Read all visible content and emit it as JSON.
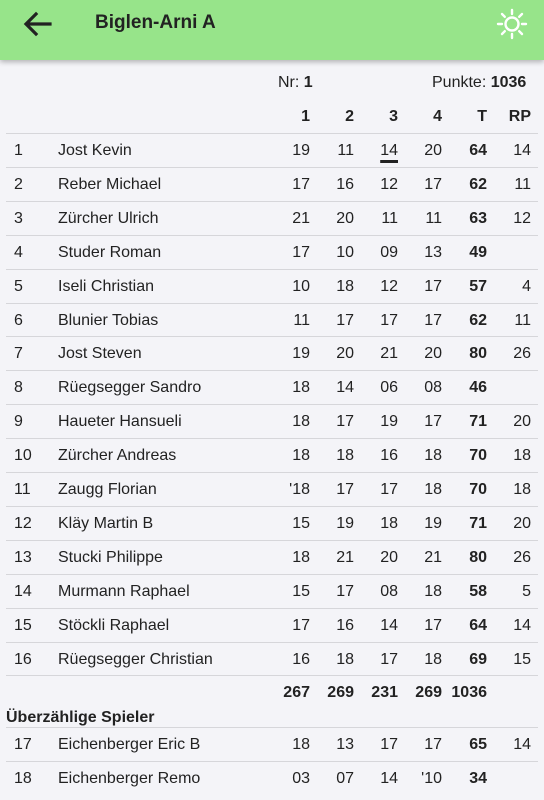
{
  "appbar": {
    "title": "Biglen-Arni A"
  },
  "info": {
    "nr_label": "Nr:",
    "nr_value": "1",
    "punkte_label": "Punkte:",
    "punkte_value": "1036"
  },
  "headers": [
    "1",
    "2",
    "3",
    "4",
    "T",
    "RP"
  ],
  "players": [
    {
      "rank": "1",
      "name": "Jost Kevin",
      "s": [
        "19",
        "11",
        "14",
        "20"
      ],
      "t": "64",
      "rp": "14",
      "underline": 2
    },
    {
      "rank": "2",
      "name": "Reber Michael",
      "s": [
        "17",
        "16",
        "12",
        "17"
      ],
      "t": "62",
      "rp": "11"
    },
    {
      "rank": "3",
      "name": "Zürcher Ulrich",
      "s": [
        "21",
        "20",
        "11",
        "11"
      ],
      "t": "63",
      "rp": "12"
    },
    {
      "rank": "4",
      "name": "Studer Roman",
      "s": [
        "17",
        "10",
        "09",
        "13"
      ],
      "t": "49",
      "rp": ""
    },
    {
      "rank": "5",
      "name": "Iseli Christian",
      "s": [
        "10",
        "18",
        "12",
        "17"
      ],
      "t": "57",
      "rp": "4"
    },
    {
      "rank": "6",
      "name": "Blunier Tobias",
      "s": [
        "11",
        "17",
        "17",
        "17"
      ],
      "t": "62",
      "rp": "11"
    },
    {
      "rank": "7",
      "name": "Jost Steven",
      "s": [
        "19",
        "20",
        "21",
        "20"
      ],
      "t": "80",
      "rp": "26"
    },
    {
      "rank": "8",
      "name": "Rüegsegger Sandro",
      "s": [
        "18",
        "14",
        "06",
        "08"
      ],
      "t": "46",
      "rp": ""
    },
    {
      "rank": "9",
      "name": "Haueter Hansueli",
      "s": [
        "18",
        "17",
        "19",
        "17"
      ],
      "t": "71",
      "rp": "20"
    },
    {
      "rank": "10",
      "name": "Zürcher Andreas",
      "s": [
        "18",
        "18",
        "16",
        "18"
      ],
      "t": "70",
      "rp": "18"
    },
    {
      "rank": "11",
      "name": "Zaugg Florian",
      "s": [
        "'18",
        "17",
        "17",
        "18"
      ],
      "t": "70",
      "rp": "18"
    },
    {
      "rank": "12",
      "name": "Kläy Martin B",
      "s": [
        "15",
        "19",
        "18",
        "19"
      ],
      "t": "71",
      "rp": "20"
    },
    {
      "rank": "13",
      "name": "Stucki Philippe",
      "s": [
        "18",
        "21",
        "20",
        "21"
      ],
      "t": "80",
      "rp": "26"
    },
    {
      "rank": "14",
      "name": "Murmann Raphael",
      "s": [
        "15",
        "17",
        "08",
        "18"
      ],
      "t": "58",
      "rp": "5"
    },
    {
      "rank": "15",
      "name": "Stöckli Raphael",
      "s": [
        "17",
        "16",
        "14",
        "17"
      ],
      "t": "64",
      "rp": "14"
    },
    {
      "rank": "16",
      "name": "Rüegsegger Christian",
      "s": [
        "16",
        "18",
        "17",
        "18"
      ],
      "t": "69",
      "rp": "15"
    }
  ],
  "totals": [
    "267",
    "269",
    "231",
    "269",
    "1036"
  ],
  "extra_section_label": "Überzählige Spieler",
  "extra_players": [
    {
      "rank": "17",
      "name": "Eichenberger Eric B",
      "s": [
        "18",
        "13",
        "17",
        "17"
      ],
      "t": "65",
      "rp": "14"
    },
    {
      "rank": "18",
      "name": "Eichenberger Remo",
      "s": [
        "03",
        "07",
        "14",
        "'10"
      ],
      "t": "34",
      "rp": ""
    }
  ],
  "colors": {
    "appbar": "#97e48a",
    "background": "#f4f4f8",
    "divider": "#d6d6da"
  },
  "icons": {
    "back": "arrow-left-icon",
    "theme": "sun-icon"
  }
}
